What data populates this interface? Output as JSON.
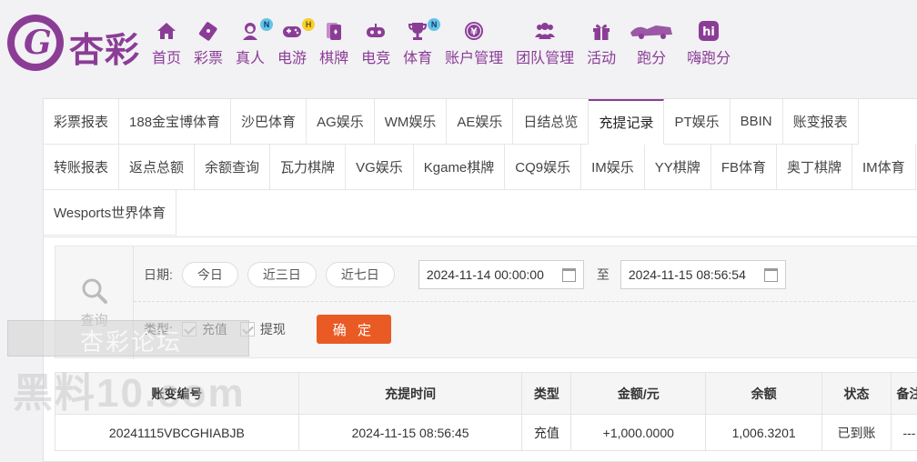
{
  "brand": {
    "logo_text": "杏彩",
    "logo_letter": "G",
    "primary_color": "#8b3d96"
  },
  "nav": [
    {
      "label": "首页",
      "icon": "home-icon",
      "badge": ""
    },
    {
      "label": "彩票",
      "icon": "lottery-ticket-icon",
      "badge": ""
    },
    {
      "label": "真人",
      "icon": "live-dealer-icon",
      "badge": "N"
    },
    {
      "label": "电游",
      "icon": "gamepad-icon",
      "badge": "H"
    },
    {
      "label": "棋牌",
      "icon": "cards-icon",
      "badge": ""
    },
    {
      "label": "电竞",
      "icon": "esports-controller-icon",
      "badge": ""
    },
    {
      "label": "体育",
      "icon": "trophy-icon",
      "badge": "N"
    },
    {
      "label": "账户管理",
      "icon": "yen-coin-icon",
      "badge": ""
    },
    {
      "label": "团队管理",
      "icon": "team-icon",
      "badge": ""
    },
    {
      "label": "活动",
      "icon": "gift-icon",
      "badge": ""
    },
    {
      "label": "跑分",
      "icon": "racing-icon",
      "badge": ""
    },
    {
      "label": "嗨跑分",
      "icon": "hi-app-icon",
      "badge": ""
    }
  ],
  "tabs_row1": [
    "彩票报表",
    "188金宝博体育",
    "沙巴体育",
    "AG娱乐",
    "WM娱乐",
    "AE娱乐",
    "日结总览",
    "充提记录",
    "PT娱乐",
    "BBIN",
    "账变报表"
  ],
  "tabs_row2": [
    "转账报表",
    "返点总额",
    "余额查询",
    "瓦力棋牌",
    "VG娱乐",
    "Kgame棋牌",
    "CQ9娱乐",
    "IM娱乐",
    "YY棋牌",
    "FB体育",
    "奥丁棋牌",
    "IM体育"
  ],
  "tabs_row3": [
    "Wesports世界体育"
  ],
  "active_tab": "充提记录",
  "filter": {
    "query_label": "查询",
    "date_label": "日期:",
    "quick_ranges": [
      "今日",
      "近三日",
      "近七日"
    ],
    "start_date": "2024-11-14 00:00:00",
    "to_label": "至",
    "end_date": "2024-11-15 08:56:54",
    "type_label": "类型:",
    "types": [
      "充值",
      "提现"
    ],
    "confirm_label": "确 定"
  },
  "table": {
    "headers": [
      "账变编号",
      "充提时间",
      "类型",
      "金额/元",
      "余额",
      "状态",
      "备注"
    ],
    "rows": [
      [
        "20241115VBCGHIABJB",
        "2024-11-15 08:56:45",
        "充值",
        "+1,000.0000",
        "1,006.3201",
        "已到账",
        "---"
      ]
    ]
  },
  "watermark": {
    "line1": "杏彩论坛",
    "line2": "黑料10.com"
  }
}
